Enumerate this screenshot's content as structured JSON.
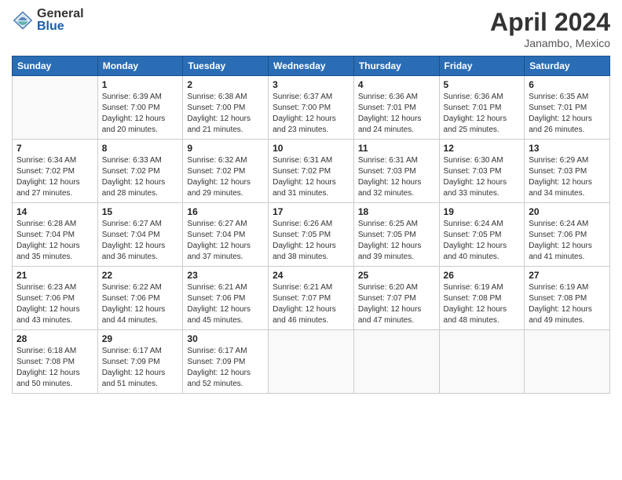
{
  "logo": {
    "general": "General",
    "blue": "Blue"
  },
  "title": "April 2024",
  "location": "Janambo, Mexico",
  "days_of_week": [
    "Sunday",
    "Monday",
    "Tuesday",
    "Wednesday",
    "Thursday",
    "Friday",
    "Saturday"
  ],
  "weeks": [
    [
      {
        "day": "",
        "info": ""
      },
      {
        "day": "1",
        "info": "Sunrise: 6:39 AM\nSunset: 7:00 PM\nDaylight: 12 hours\nand 20 minutes."
      },
      {
        "day": "2",
        "info": "Sunrise: 6:38 AM\nSunset: 7:00 PM\nDaylight: 12 hours\nand 21 minutes."
      },
      {
        "day": "3",
        "info": "Sunrise: 6:37 AM\nSunset: 7:00 PM\nDaylight: 12 hours\nand 23 minutes."
      },
      {
        "day": "4",
        "info": "Sunrise: 6:36 AM\nSunset: 7:01 PM\nDaylight: 12 hours\nand 24 minutes."
      },
      {
        "day": "5",
        "info": "Sunrise: 6:36 AM\nSunset: 7:01 PM\nDaylight: 12 hours\nand 25 minutes."
      },
      {
        "day": "6",
        "info": "Sunrise: 6:35 AM\nSunset: 7:01 PM\nDaylight: 12 hours\nand 26 minutes."
      }
    ],
    [
      {
        "day": "7",
        "info": "Sunrise: 6:34 AM\nSunset: 7:02 PM\nDaylight: 12 hours\nand 27 minutes."
      },
      {
        "day": "8",
        "info": "Sunrise: 6:33 AM\nSunset: 7:02 PM\nDaylight: 12 hours\nand 28 minutes."
      },
      {
        "day": "9",
        "info": "Sunrise: 6:32 AM\nSunset: 7:02 PM\nDaylight: 12 hours\nand 29 minutes."
      },
      {
        "day": "10",
        "info": "Sunrise: 6:31 AM\nSunset: 7:02 PM\nDaylight: 12 hours\nand 31 minutes."
      },
      {
        "day": "11",
        "info": "Sunrise: 6:31 AM\nSunset: 7:03 PM\nDaylight: 12 hours\nand 32 minutes."
      },
      {
        "day": "12",
        "info": "Sunrise: 6:30 AM\nSunset: 7:03 PM\nDaylight: 12 hours\nand 33 minutes."
      },
      {
        "day": "13",
        "info": "Sunrise: 6:29 AM\nSunset: 7:03 PM\nDaylight: 12 hours\nand 34 minutes."
      }
    ],
    [
      {
        "day": "14",
        "info": "Sunrise: 6:28 AM\nSunset: 7:04 PM\nDaylight: 12 hours\nand 35 minutes."
      },
      {
        "day": "15",
        "info": "Sunrise: 6:27 AM\nSunset: 7:04 PM\nDaylight: 12 hours\nand 36 minutes."
      },
      {
        "day": "16",
        "info": "Sunrise: 6:27 AM\nSunset: 7:04 PM\nDaylight: 12 hours\nand 37 minutes."
      },
      {
        "day": "17",
        "info": "Sunrise: 6:26 AM\nSunset: 7:05 PM\nDaylight: 12 hours\nand 38 minutes."
      },
      {
        "day": "18",
        "info": "Sunrise: 6:25 AM\nSunset: 7:05 PM\nDaylight: 12 hours\nand 39 minutes."
      },
      {
        "day": "19",
        "info": "Sunrise: 6:24 AM\nSunset: 7:05 PM\nDaylight: 12 hours\nand 40 minutes."
      },
      {
        "day": "20",
        "info": "Sunrise: 6:24 AM\nSunset: 7:06 PM\nDaylight: 12 hours\nand 41 minutes."
      }
    ],
    [
      {
        "day": "21",
        "info": "Sunrise: 6:23 AM\nSunset: 7:06 PM\nDaylight: 12 hours\nand 43 minutes."
      },
      {
        "day": "22",
        "info": "Sunrise: 6:22 AM\nSunset: 7:06 PM\nDaylight: 12 hours\nand 44 minutes."
      },
      {
        "day": "23",
        "info": "Sunrise: 6:21 AM\nSunset: 7:06 PM\nDaylight: 12 hours\nand 45 minutes."
      },
      {
        "day": "24",
        "info": "Sunrise: 6:21 AM\nSunset: 7:07 PM\nDaylight: 12 hours\nand 46 minutes."
      },
      {
        "day": "25",
        "info": "Sunrise: 6:20 AM\nSunset: 7:07 PM\nDaylight: 12 hours\nand 47 minutes."
      },
      {
        "day": "26",
        "info": "Sunrise: 6:19 AM\nSunset: 7:08 PM\nDaylight: 12 hours\nand 48 minutes."
      },
      {
        "day": "27",
        "info": "Sunrise: 6:19 AM\nSunset: 7:08 PM\nDaylight: 12 hours\nand 49 minutes."
      }
    ],
    [
      {
        "day": "28",
        "info": "Sunrise: 6:18 AM\nSunset: 7:08 PM\nDaylight: 12 hours\nand 50 minutes."
      },
      {
        "day": "29",
        "info": "Sunrise: 6:17 AM\nSunset: 7:09 PM\nDaylight: 12 hours\nand 51 minutes."
      },
      {
        "day": "30",
        "info": "Sunrise: 6:17 AM\nSunset: 7:09 PM\nDaylight: 12 hours\nand 52 minutes."
      },
      {
        "day": "",
        "info": ""
      },
      {
        "day": "",
        "info": ""
      },
      {
        "day": "",
        "info": ""
      },
      {
        "day": "",
        "info": ""
      }
    ]
  ]
}
